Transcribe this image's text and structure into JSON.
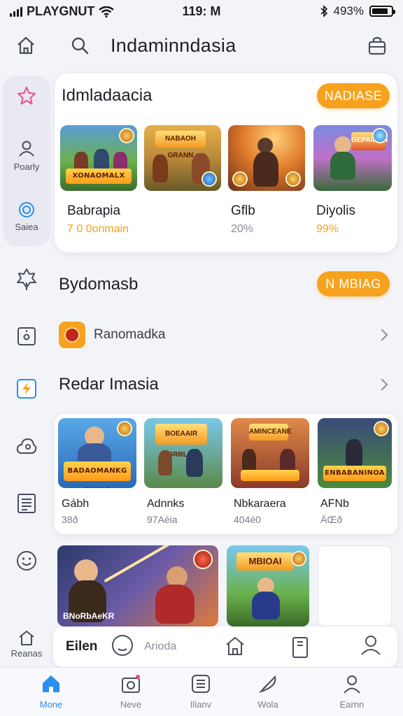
{
  "status": {
    "carrier": "PLAYGNUT",
    "time": "119: M",
    "battery": "493%"
  },
  "header": {
    "title": "Indaminndasia"
  },
  "rail": {
    "items": [
      {
        "icon": "star-icon",
        "label": ""
      },
      {
        "icon": "person-icon",
        "label": "Poarly"
      },
      {
        "icon": "target-icon",
        "label": "Saiea"
      },
      {
        "icon": "tree-icon",
        "label": ""
      },
      {
        "icon": "lock-icon",
        "label": ""
      },
      {
        "icon": "flash-icon",
        "label": ""
      },
      {
        "icon": "cloud-icon",
        "label": ""
      },
      {
        "icon": "newspaper-icon",
        "label": ""
      },
      {
        "icon": "smiley-icon",
        "label": ""
      },
      {
        "icon": "home-icon",
        "label": "Reanas"
      }
    ]
  },
  "featured": {
    "title": "Idmladaacia",
    "action": "NADIASE",
    "games": [
      {
        "name": "Babrapia",
        "sub": "7 0 0onmain",
        "tile_banner": "XONAOMALX"
      },
      {
        "name": "Gflb",
        "sub": "20%",
        "tile_banner": "NABAOH GRANN"
      },
      {
        "name": "Diyolis",
        "sub": "99%",
        "tile_banner": "GEPAIPOH"
      },
      {
        "name": "",
        "sub": "",
        "tile_banner": ""
      }
    ],
    "sub_colors": [
      "#f5a11d",
      "#8a8e99",
      "#f5a11d"
    ]
  },
  "section2": {
    "title": "Bydomasb",
    "action": "N MBIAG",
    "row_label": "Ranomadka"
  },
  "section3": {
    "title": "Redar Imasia",
    "games": [
      {
        "name": "Gábh",
        "sub": "38ð",
        "tile_banner": "BADAOMANKG ONNIR"
      },
      {
        "name": "Adnnks",
        "sub": "97Aéia",
        "tile_banner": "BOEAAIR ORRLIG"
      },
      {
        "name": "Nbkaraera",
        "sub": "404é0",
        "tile_banner": "AMINCEANE"
      },
      {
        "name": "AFNb",
        "sub": "ÄŒð",
        "tile_banner": "ENBABANINOA"
      }
    ],
    "big_tiles": [
      {
        "caption": "BNoRbAeKR"
      },
      {
        "caption": "MBIOAI"
      }
    ]
  },
  "sheet": {
    "filter_label": "Eilen",
    "search_placeholder": "Arioda"
  },
  "bottom_nav": [
    {
      "label": "Mone",
      "icon": "home-icon",
      "active": true
    },
    {
      "label": "Neve",
      "icon": "camera-icon",
      "active": false
    },
    {
      "label": "Ilianv",
      "icon": "list-icon",
      "active": false
    },
    {
      "label": "Wola",
      "icon": "feather-icon",
      "active": false
    },
    {
      "label": "Earnn",
      "icon": "profile-icon",
      "active": false
    }
  ],
  "colors": {
    "accent": "#f7a21f",
    "active_nav": "#2a8ff0",
    "star": "#e85a8c",
    "target": "#2a8ff0"
  }
}
